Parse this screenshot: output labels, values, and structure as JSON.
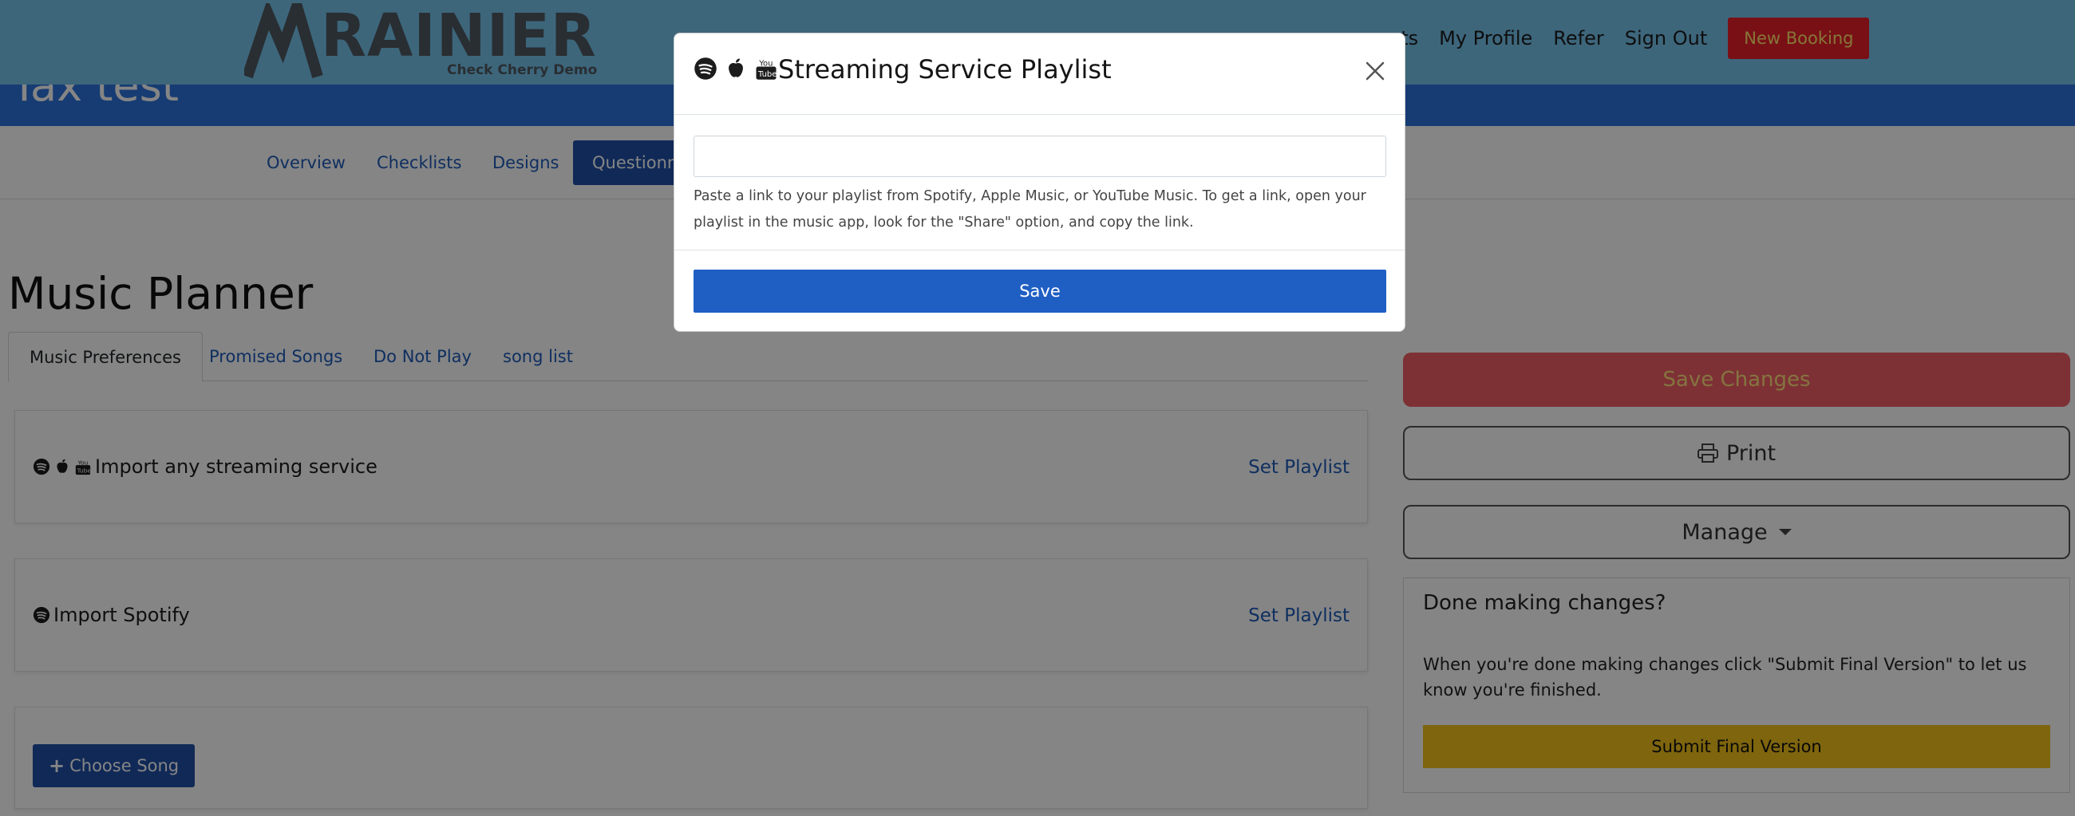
{
  "header": {
    "event_title": "Tax test",
    "logo_text": "RAINIER",
    "logo_subtitle": "Check Cherry Demo",
    "nav": [
      {
        "label": "nts"
      },
      {
        "label": "My Profile"
      },
      {
        "label": "Refer"
      },
      {
        "label": "Sign Out"
      }
    ],
    "new_booking_label": "New Booking",
    "colors": {
      "header": "#76c3ec",
      "band": "#2d74dc",
      "new_booking": "#e8202a"
    }
  },
  "subnav": {
    "tabs": [
      {
        "label": "Overview"
      },
      {
        "label": "Checklists"
      },
      {
        "label": "Designs"
      },
      {
        "label": "Questionna"
      }
    ],
    "active_index": 3
  },
  "main": {
    "title": "Music Planner",
    "tabs": [
      {
        "label": "Music Preferences"
      },
      {
        "label": "Promised Songs"
      },
      {
        "label": "Do Not Play"
      },
      {
        "label": "song list"
      }
    ],
    "active_tab": 0,
    "import_any": {
      "label": "Import any streaming service",
      "link": "Set Playlist",
      "icons": [
        "spotify-icon",
        "apple-icon",
        "youtube-icon"
      ]
    },
    "import_spotify": {
      "label": "Import Spotify",
      "link": "Set Playlist",
      "icons": [
        "spotify-icon"
      ]
    },
    "choose_song_label": "Choose Song"
  },
  "sidebar": {
    "save_changes_label": "Save Changes",
    "print_label": "Print",
    "manage_label": "Manage",
    "done": {
      "title": "Done making changes?",
      "text": "When you're done making changes click \"Submit Final Version\" to let us know you're finished.",
      "submit_label": "Submit Final Version"
    },
    "colors": {
      "save_changes": "#ef5e66",
      "submit_final": "#f2c21c"
    }
  },
  "modal": {
    "title": "Streaming Service Playlist",
    "icons": [
      "spotify-icon",
      "apple-icon",
      "youtube-icon"
    ],
    "input": {
      "value": "",
      "placeholder": ""
    },
    "help_text": "Paste a link to your playlist from Spotify, Apple Music, or YouTube Music. To get a link, open your playlist in the music app, look for the \"Share\" option, and copy the link.",
    "save_label": "Save",
    "colors": {
      "save": "#1f5fc4"
    }
  }
}
